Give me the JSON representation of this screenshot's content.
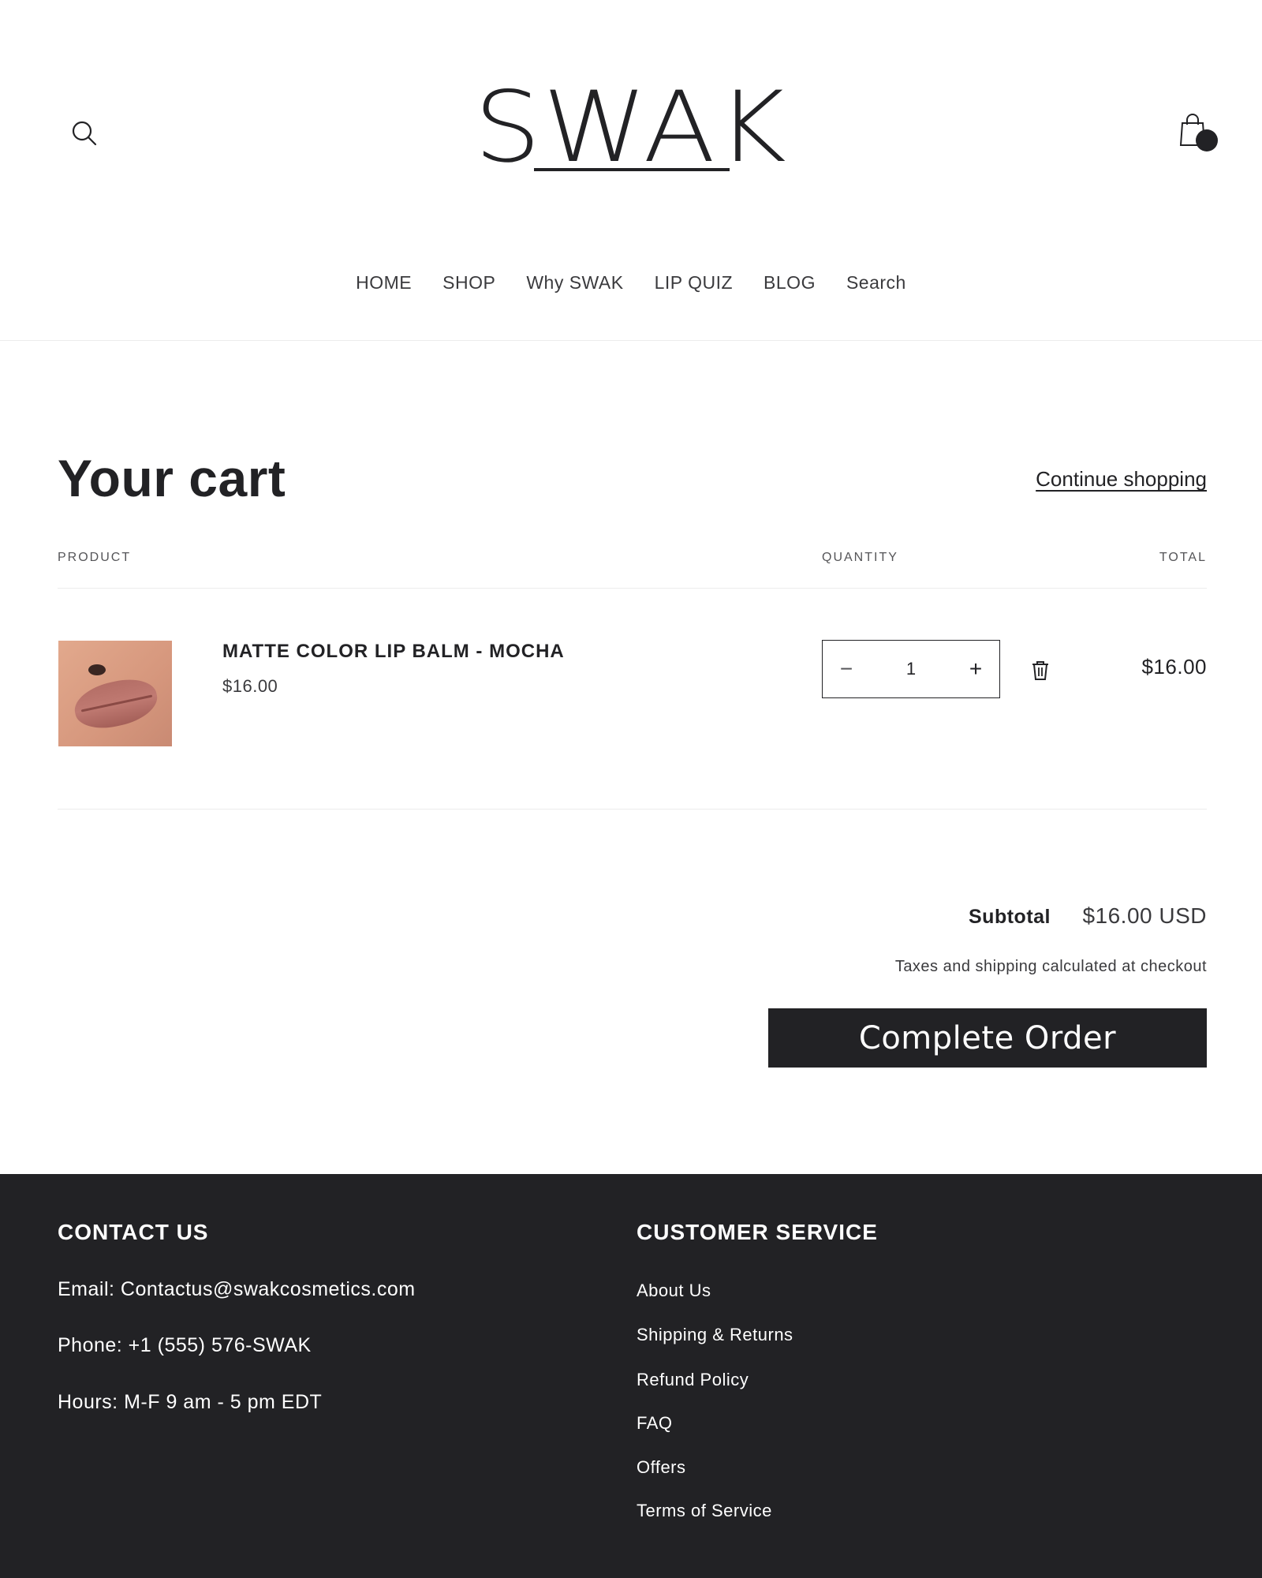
{
  "header": {
    "logo_text": "SWAK",
    "search_icon": "search-icon",
    "cart_icon": "shopping-bag-icon",
    "nav": [
      "HOME",
      "SHOP",
      "Why SWAK",
      "LIP QUIZ",
      "BLOG",
      "Search"
    ]
  },
  "cart": {
    "title": "Your cart",
    "continue_label": "Continue shopping",
    "columns": {
      "product": "PRODUCT",
      "quantity": "QUANTITY",
      "total": "TOTAL"
    },
    "items": [
      {
        "name": "MATTE COLOR LIP BALM - MOCHA",
        "price": "$16.00",
        "quantity": "1",
        "line_total": "$16.00",
        "image_icon": "lip-product-thumbnail"
      }
    ],
    "qty_minus": "−",
    "qty_plus": "+",
    "remove_icon": "trash-icon",
    "subtotal_label": "Subtotal",
    "subtotal_value": "$16.00 USD",
    "tax_note": "Taxes and shipping calculated at checkout",
    "checkout_label": "Complete Order"
  },
  "footer": {
    "contact_heading": "CONTACT US",
    "email": "Email: Contactus@swakcosmetics.com",
    "phone": "Phone: +1 (555) 576-SWAK",
    "hours": "Hours: M-F 9 am - 5 pm EDT",
    "service_heading": "CUSTOMER SERVICE",
    "service_links": [
      "About Us",
      "Shipping & Returns",
      "Refund Policy",
      "FAQ",
      "Offers",
      "Terms of Service"
    ]
  },
  "colors": {
    "primary_dark": "#222225",
    "text_muted": "#3a3a3d",
    "divider": "#ececec",
    "background": "#ffffff"
  }
}
